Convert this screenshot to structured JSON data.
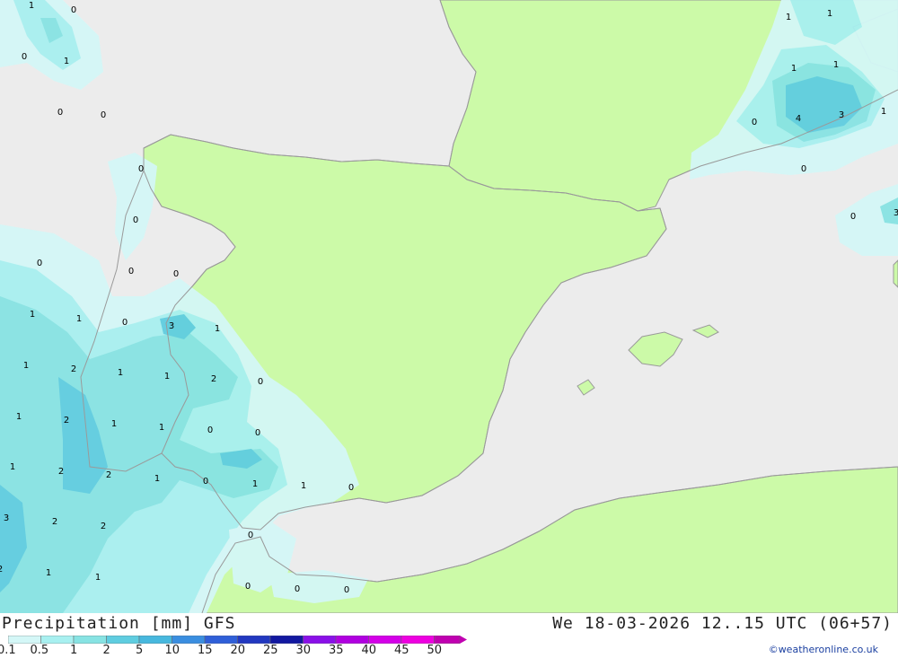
{
  "title": "Precipitation [mm] GFS",
  "datetime": "We 18-03-2026 12..15 UTC (06+57)",
  "credit": "©weatheronline.co.uk",
  "colors": {
    "sea": "#ececec",
    "land": "#ccfaa8",
    "coast": "#9a9a9a",
    "precip": [
      "#d4f7f7",
      "#a8f0f0",
      "#87e3e3",
      "#5fcde0",
      "#47b8de"
    ]
  },
  "legend": {
    "labels": [
      "0.1",
      "0.5",
      "1",
      "2",
      "5",
      "10",
      "15",
      "20",
      "25",
      "30",
      "35",
      "40",
      "45",
      "50"
    ],
    "colors": [
      "#d4f7f7",
      "#a8f0f0",
      "#87e3e3",
      "#5fcde0",
      "#47b8de",
      "#3a8ee0",
      "#2f5fd8",
      "#2238c0",
      "#1218a0",
      "#8a10e8",
      "#b000e0",
      "#d400e8",
      "#ee00e0",
      "#c000b0"
    ]
  },
  "map_values": [
    "1",
    "0",
    "0",
    "1",
    "0",
    "0",
    "0",
    "0",
    "0",
    "0",
    "0",
    "1",
    "1",
    "0",
    "3",
    "1",
    "1",
    "2",
    "1",
    "1",
    "2",
    "0",
    "1",
    "2",
    "1",
    "1",
    "0",
    "0",
    "1",
    "2",
    "2",
    "1",
    "0",
    "1",
    "1",
    "0",
    "3",
    "2",
    "2",
    "0",
    "2",
    "1",
    "1",
    "0",
    "0",
    "0",
    "1",
    "1",
    "1",
    "1",
    "4",
    "3",
    "1",
    "0",
    "0",
    "0",
    "3"
  ]
}
